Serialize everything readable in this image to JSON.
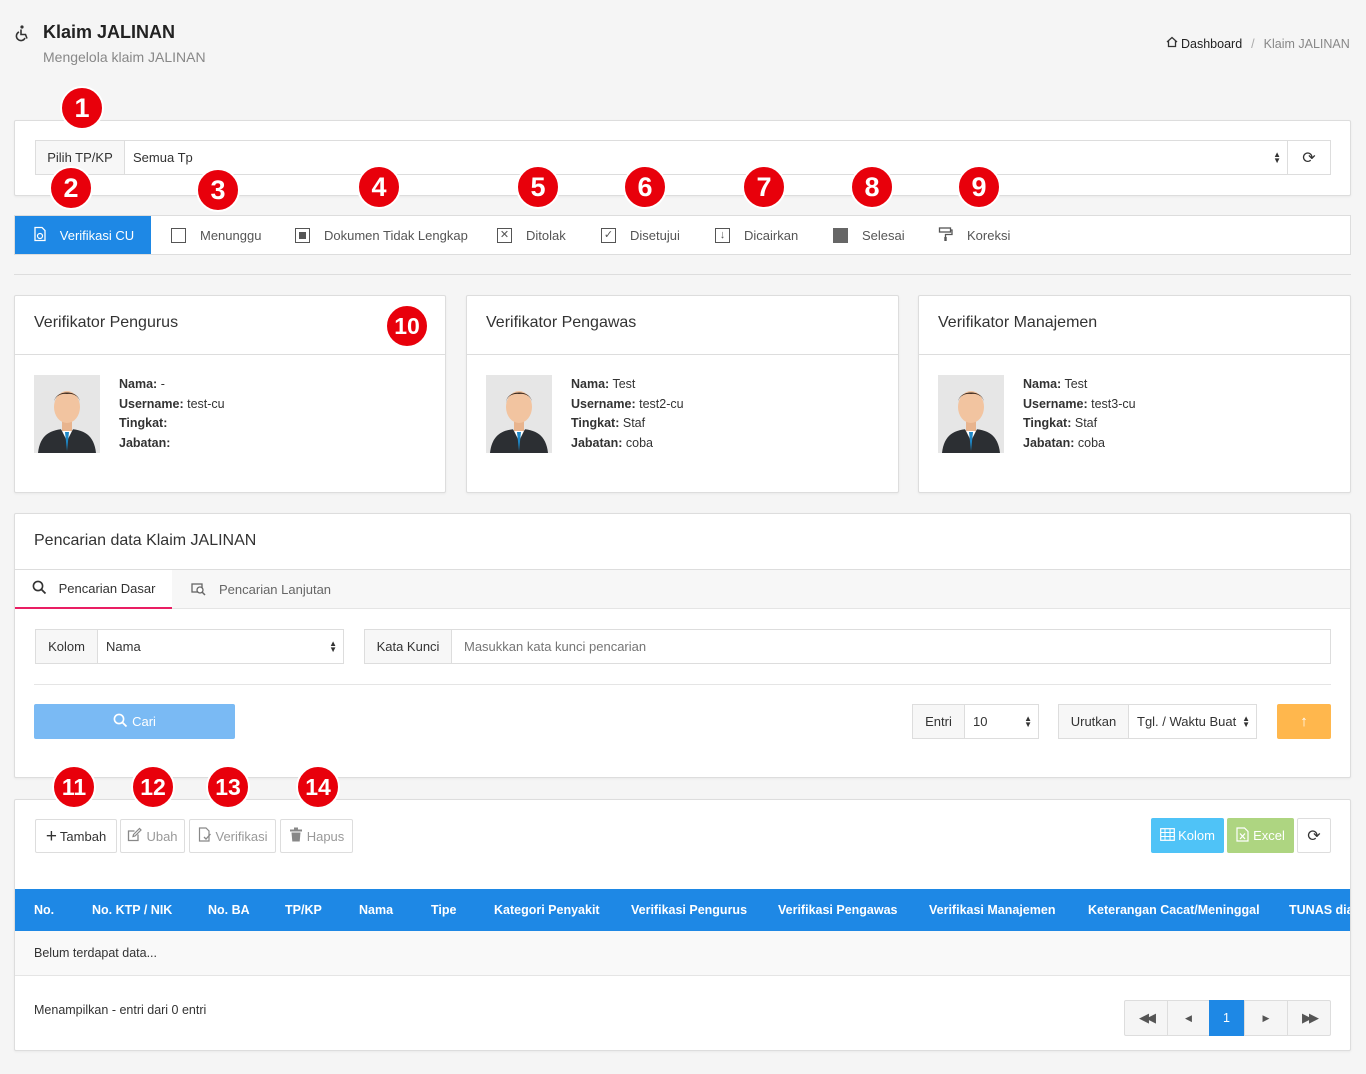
{
  "header": {
    "title": "Klaim JALINAN",
    "subtitle": "Mengelola klaim JALINAN",
    "breadcrumb_home": "Dashboard",
    "breadcrumb_sep": "/",
    "breadcrumb_current": "Klaim JALINAN"
  },
  "markers": [
    "1",
    "2",
    "3",
    "4",
    "5",
    "6",
    "7",
    "8",
    "9",
    "10",
    "11",
    "12",
    "13",
    "14"
  ],
  "filter": {
    "label": "Pilih TP/KP",
    "value": "Semua Tp"
  },
  "tabs": [
    {
      "label": "Verifikasi CU",
      "icon": "verify-doc-icon",
      "active": true
    },
    {
      "label": "Menunggu",
      "icon": "empty-square-icon"
    },
    {
      "label": "Dokumen Tidak Lengkap",
      "icon": "filled-inner-square-icon"
    },
    {
      "label": "Ditolak",
      "icon": "x-square-icon"
    },
    {
      "label": "Disetujui",
      "icon": "check-square-icon"
    },
    {
      "label": "Dicairkan",
      "icon": "download-square-icon"
    },
    {
      "label": "Selesai",
      "icon": "solid-square-icon"
    },
    {
      "label": "Koreksi",
      "icon": "paint-roller-icon"
    }
  ],
  "verifiers": [
    {
      "title": "Verifikator Pengurus",
      "nama_label": "Nama:",
      "nama": "-",
      "username_label": "Username:",
      "username": "test-cu",
      "tingkat_label": "Tingkat:",
      "tingkat": "",
      "jabatan_label": "Jabatan:",
      "jabatan": ""
    },
    {
      "title": "Verifikator Pengawas",
      "nama_label": "Nama:",
      "nama": "Test",
      "username_label": "Username:",
      "username": "test2-cu",
      "tingkat_label": "Tingkat:",
      "tingkat": "Staf",
      "jabatan_label": "Jabatan:",
      "jabatan": "coba"
    },
    {
      "title": "Verifikator Manajemen",
      "nama_label": "Nama:",
      "nama": "Test",
      "username_label": "Username:",
      "username": "test3-cu",
      "tingkat_label": "Tingkat:",
      "tingkat": "Staf",
      "jabatan_label": "Jabatan:",
      "jabatan": "coba"
    }
  ],
  "search": {
    "title": "Pencarian data Klaim JALINAN",
    "tab_basic": "Pencarian Dasar",
    "tab_advanced": "Pencarian Lanjutan",
    "kolom_label": "Kolom",
    "kolom_value": "Nama",
    "keyword_label": "Kata Kunci",
    "keyword_placeholder": "Masukkan kata kunci pencarian",
    "search_button": "Cari",
    "entri_label": "Entri",
    "entri_value": "10",
    "urutkan_label": "Urutkan",
    "urutkan_value": "Tgl. / Waktu Buat"
  },
  "toolbar": {
    "add": "Tambah",
    "edit": "Ubah",
    "verify": "Verifikasi",
    "delete": "Hapus",
    "columns": "Kolom",
    "excel": "Excel"
  },
  "table": {
    "columns": [
      "No.",
      "No. KTP / NIK",
      "No. BA",
      "TP/KP",
      "Nama",
      "Tipe",
      "Kategori Penyakit",
      "Verifikasi Pengurus",
      "Verifikasi Pengawas",
      "Verifikasi Manajemen",
      "Keterangan Cacat/Meninggal",
      "TUNAS dia"
    ],
    "empty_message": "Belum terdapat data...",
    "footer_info": "Menampilkan - entri dari 0 entri"
  },
  "pagination": {
    "current": "1"
  },
  "colors": {
    "primary": "#1e88e5",
    "marker": "#e8000b",
    "search_btn": "#7abaf4",
    "sort_btn": "#ffb74d",
    "columns_btn": "#4fc3f7",
    "excel_btn": "#aed581"
  }
}
